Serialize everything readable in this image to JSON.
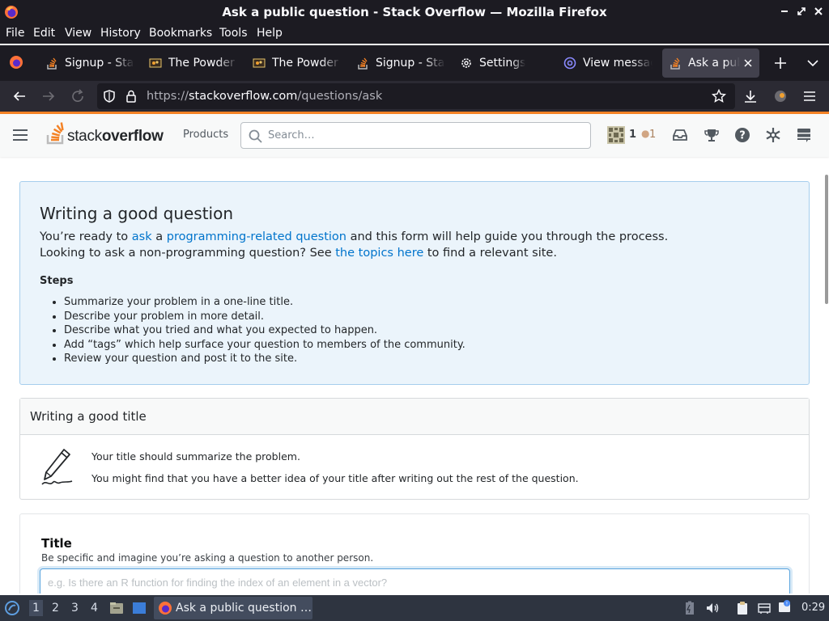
{
  "window": {
    "title": "Ask a public question - Stack Overflow — Mozilla Firefox"
  },
  "menubar": {
    "items": [
      "File",
      "Edit",
      "View",
      "History",
      "Bookmarks",
      "Tools",
      "Help"
    ]
  },
  "tabs": [
    {
      "label": "Signup - Stack Overflow",
      "icon": "stackoverflow-icon"
    },
    {
      "label": "The Powder Toy",
      "icon": "powder-toy-icon"
    },
    {
      "label": "The Powder Toy",
      "icon": "powder-toy-icon"
    },
    {
      "label": "Signup - Stack Overflow",
      "icon": "stackoverflow-icon"
    },
    {
      "label": "Settings",
      "icon": "gear-icon"
    },
    {
      "label": "View messages",
      "icon": "mail-icon"
    },
    {
      "label": "Ask a public question",
      "icon": "stackoverflow-icon",
      "active": true
    }
  ],
  "navbar": {
    "url_prefix": "https://",
    "url_host": "stackoverflow.com",
    "url_path": "/questions/ask"
  },
  "so_header": {
    "logo_text_light": "stack",
    "logo_text_bold": "overflow",
    "products": "Products",
    "search_placeholder": "Search…",
    "reputation": "1",
    "bronze_badges": "1"
  },
  "good_question": {
    "heading": "Writing a good question",
    "p1_a": "You’re ready to ",
    "p1_link1": "ask",
    "p1_b": " a ",
    "p1_link2": "programming-related question",
    "p1_c": " and this form will help guide you through the process.",
    "p2_a": "Looking to ask a non-programming question? See ",
    "p2_link": "the topics here",
    "p2_b": " to find a relevant site.",
    "steps_heading": "Steps",
    "steps": [
      "Summarize your problem in a one-line title.",
      "Describe your problem in more detail.",
      "Describe what you tried and what you expected to happen.",
      "Add “tags” which help surface your question to members of the community.",
      "Review your question and post it to the site."
    ]
  },
  "title_help": {
    "heading": "Writing a good title",
    "line1": "Your title should summarize the problem.",
    "line2": "You might find that you have a better idea of your title after writing out the rest of the question."
  },
  "title_form": {
    "label": "Title",
    "description": "Be specific and imagine you’re asking a question to another person.",
    "placeholder": "e.g. Is there an R function for finding the index of an element in a vector?",
    "value": ""
  },
  "taskbar": {
    "workspaces": [
      "1",
      "2",
      "3",
      "4"
    ],
    "active_task": "Ask a public question …",
    "clock": "0:29"
  },
  "colors": {
    "so_orange": "#f48225",
    "link_blue": "#0074cc",
    "notice_bg": "#ebf4fb"
  }
}
